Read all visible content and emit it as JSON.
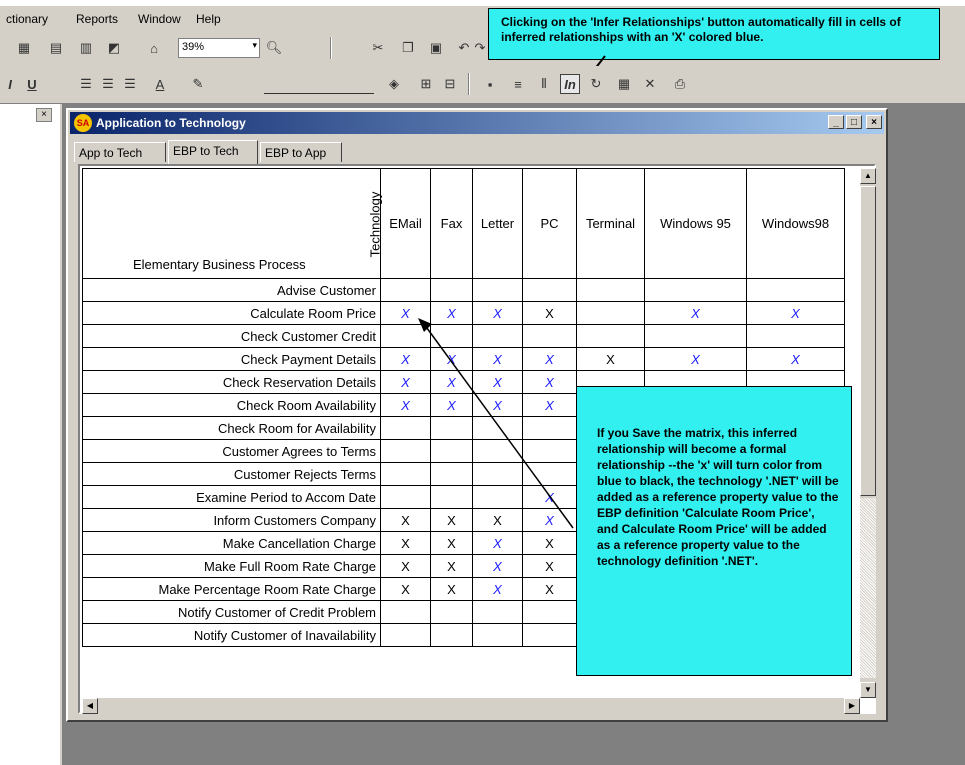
{
  "menubar": {
    "items": [
      "ctionary",
      "Reports",
      "Window",
      "Help"
    ]
  },
  "toolbar": {
    "zoom_value": "39%"
  },
  "callout_top": {
    "text": "Clicking on the 'Infer Relationships' button automatically fill in cells of inferred relationships with an 'X' colored blue."
  },
  "window": {
    "title": "Application to Technology",
    "logo": "SA",
    "tabs": [
      "App to Tech",
      "EBP to Tech",
      "EBP to App"
    ],
    "active_tab": "EBP to Tech"
  },
  "grid": {
    "row_header": "Elementary Business Process",
    "col_header": "Technology",
    "columns": [
      "EMail",
      "Fax",
      "Letter",
      "PC",
      "Terminal",
      "Windows 95",
      "Windows98"
    ],
    "rows": [
      {
        "label": "Advise Customer",
        "cells": [
          "",
          "",
          "",
          "",
          "",
          "",
          ""
        ]
      },
      {
        "label": "Calculate Room Price",
        "cells": [
          "B",
          "B",
          "B",
          "K",
          "",
          "B",
          "B"
        ]
      },
      {
        "label": "Check Customer Credit",
        "cells": [
          "",
          "",
          "",
          "",
          "",
          "",
          ""
        ]
      },
      {
        "label": "Check Payment Details",
        "cells": [
          "B",
          "B",
          "B",
          "B",
          "K",
          "B",
          "B"
        ]
      },
      {
        "label": "Check Reservation Details",
        "cells": [
          "B",
          "B",
          "B",
          "B",
          "",
          "",
          ""
        ]
      },
      {
        "label": "Check Room Availability",
        "cells": [
          "B",
          "B",
          "B",
          "B",
          "",
          "",
          ""
        ]
      },
      {
        "label": "Check Room for Availability",
        "cells": [
          "",
          "",
          "",
          "",
          "",
          "",
          ""
        ]
      },
      {
        "label": "Customer Agrees to Terms",
        "cells": [
          "",
          "",
          "",
          "",
          "",
          "",
          ""
        ]
      },
      {
        "label": "Customer Rejects Terms",
        "cells": [
          "",
          "",
          "",
          "",
          "",
          "",
          ""
        ]
      },
      {
        "label": "Examine Period to Accom Date",
        "cells": [
          "",
          "",
          "",
          "B",
          "",
          "",
          ""
        ]
      },
      {
        "label": "Inform Customers Company",
        "cells": [
          "K",
          "K",
          "K",
          "B",
          "",
          "",
          ""
        ]
      },
      {
        "label": "Make Cancellation Charge",
        "cells": [
          "K",
          "K",
          "B",
          "K",
          "",
          "",
          ""
        ]
      },
      {
        "label": "Make Full Room Rate Charge",
        "cells": [
          "K",
          "K",
          "B",
          "K",
          "",
          "",
          ""
        ]
      },
      {
        "label": "Make Percentage Room Rate Charge",
        "cells": [
          "K",
          "K",
          "B",
          "K",
          "",
          "",
          ""
        ]
      },
      {
        "label": "Notify Customer of Credit Problem",
        "cells": [
          "",
          "",
          "",
          "",
          "",
          "",
          ""
        ]
      },
      {
        "label": "Notify Customer of Inavailability",
        "cells": [
          "",
          "",
          "",
          "",
          "",
          "",
          ""
        ]
      }
    ],
    "mark": "X",
    "inferred_color": "#1a1aff",
    "formal_color": "#000000"
  },
  "callout_mid": {
    "text": "If you Save the matrix, this inferred relationship will become a formal relationship --the 'x' will turn color from blue to black, the technology '.NET' will be added as a reference property value to the EBP definition 'Calculate Room Price', and Calculate Room Price' will be added as a reference property value to the technology definition '.NET'."
  },
  "colors": {
    "callout_bg": "#33f0f0",
    "titlebar_start": "#0a246a",
    "workspace": "#808080"
  }
}
